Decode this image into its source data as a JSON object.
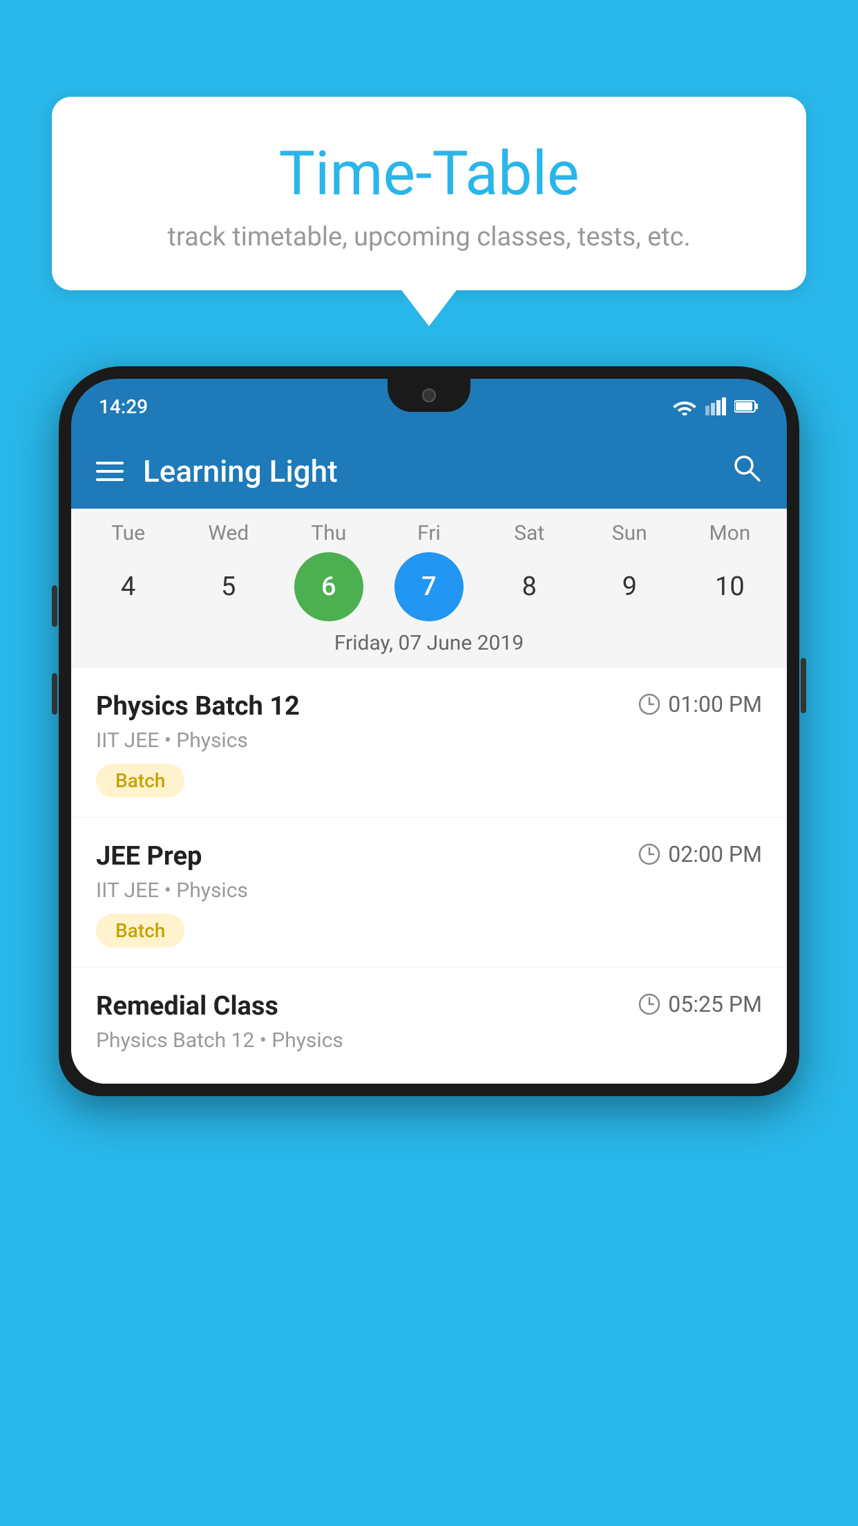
{
  "page": {
    "background_color": "#29B6E8"
  },
  "bubble": {
    "title": "Time-Table",
    "subtitle": "track timetable, upcoming classes, tests, etc."
  },
  "phone": {
    "status_bar": {
      "time": "14:29"
    },
    "app_bar": {
      "title": "Learning Light"
    },
    "calendar": {
      "days": [
        {
          "label": "Tue",
          "number": "4",
          "state": "normal"
        },
        {
          "label": "Wed",
          "number": "5",
          "state": "normal"
        },
        {
          "label": "Thu",
          "number": "6",
          "state": "today"
        },
        {
          "label": "Fri",
          "number": "7",
          "state": "selected"
        },
        {
          "label": "Sat",
          "number": "8",
          "state": "normal"
        },
        {
          "label": "Sun",
          "number": "9",
          "state": "normal"
        },
        {
          "label": "Mon",
          "number": "10",
          "state": "normal"
        }
      ],
      "selected_date_label": "Friday, 07 June 2019"
    },
    "events": [
      {
        "title": "Physics Batch 12",
        "time": "01:00 PM",
        "meta": "IIT JEE • Physics",
        "badge": "Batch"
      },
      {
        "title": "JEE Prep",
        "time": "02:00 PM",
        "meta": "IIT JEE • Physics",
        "badge": "Batch"
      },
      {
        "title": "Remedial Class",
        "time": "05:25 PM",
        "meta": "Physics Batch 12 • Physics",
        "badge": null
      }
    ]
  }
}
